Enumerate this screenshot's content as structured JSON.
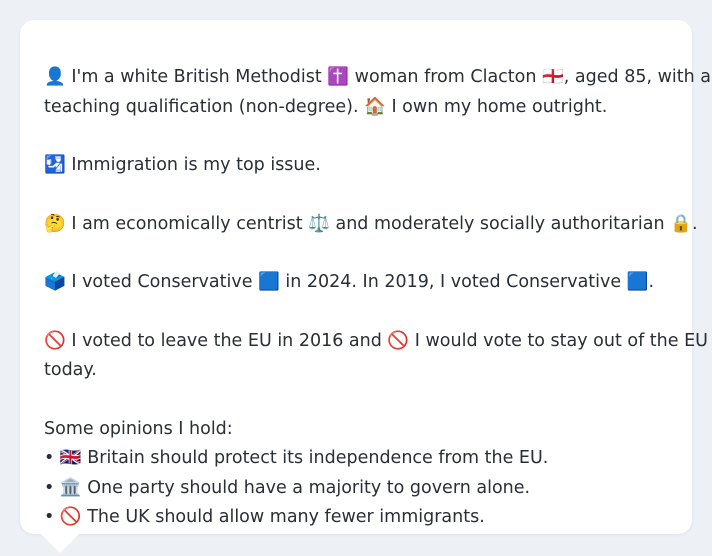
{
  "profile": {
    "intro": {
      "line1": "👤 I'm a white British Methodist ✝️ woman from Clacton 🏴󠁧󠁢󠁥󠁮󠁧󠁿, aged 85, with a",
      "line2": "teaching qualification (non-degree). 🏠 I own my home outright."
    },
    "top_issue": "🛂 Immigration is my top issue.",
    "ideology": "🤔 I am economically centrist ⚖️ and moderately socially authoritarian 🔒.",
    "votes": "🗳️ I voted Conservative 🟦 in 2024. In 2019, I voted Conservative 🟦.",
    "eu": {
      "line1": "🚫 I voted to leave the EU in 2016 and 🚫 I would vote to stay out of the EU",
      "line2": "today."
    },
    "opinions_heading": "Some opinions I hold:",
    "opinions": [
      "• 🇬🇧 Britain should protect its independence from the EU.",
      "• 🏛️ One party should have a majority to govern alone.",
      "• 🚫 The UK should allow many fewer immigrants."
    ]
  }
}
